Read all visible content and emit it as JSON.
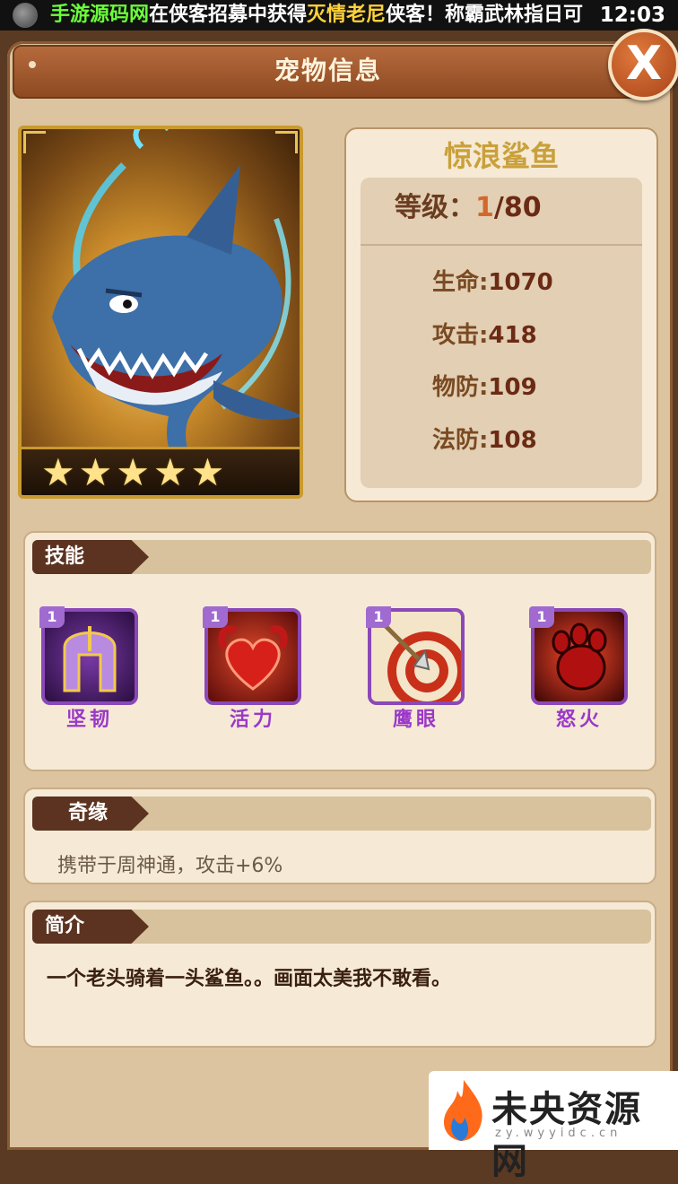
{
  "status_bar": {
    "marquee": {
      "brand": "手游源码网",
      "part1": "在侠客招募中获得",
      "highlight": "灭情老尼",
      "part2": "侠客！称霸武林指日可"
    },
    "time": "12:03"
  },
  "window": {
    "title": "宠物信息",
    "close_label": "X"
  },
  "pet": {
    "name": "惊浪鲨鱼",
    "stars": 5,
    "level_label": "等级：",
    "level_current": "1",
    "level_max": "/80",
    "stats": [
      {
        "label": "生命:",
        "value": "1070"
      },
      {
        "label": "攻击:",
        "value": "418"
      },
      {
        "label": "物防:",
        "value": "109"
      },
      {
        "label": "法防:",
        "value": "108"
      }
    ]
  },
  "skills_section": {
    "title": "技能",
    "skills": [
      {
        "level": "1",
        "name": "坚韧",
        "icon": "helmet-icon"
      },
      {
        "level": "1",
        "name": "活力",
        "icon": "muscle-heart-icon"
      },
      {
        "level": "1",
        "name": "鹰眼",
        "icon": "target-arrow-icon"
      },
      {
        "level": "1",
        "name": "怒火",
        "icon": "claw-icon"
      }
    ]
  },
  "fate_section": {
    "title": "奇缘",
    "text": "携带于周神通，攻击+6%"
  },
  "intro_section": {
    "title": "简介",
    "text": "一个老头骑着一头鲨鱼。。画面太美我不敢看。"
  },
  "watermark": {
    "text": "未央资源网",
    "sub": "zy.wyyidc.cn"
  },
  "colors": {
    "skill_name": "#9a38c8",
    "pet_name": "#c9a03a",
    "section_tab": "#5b3320"
  }
}
